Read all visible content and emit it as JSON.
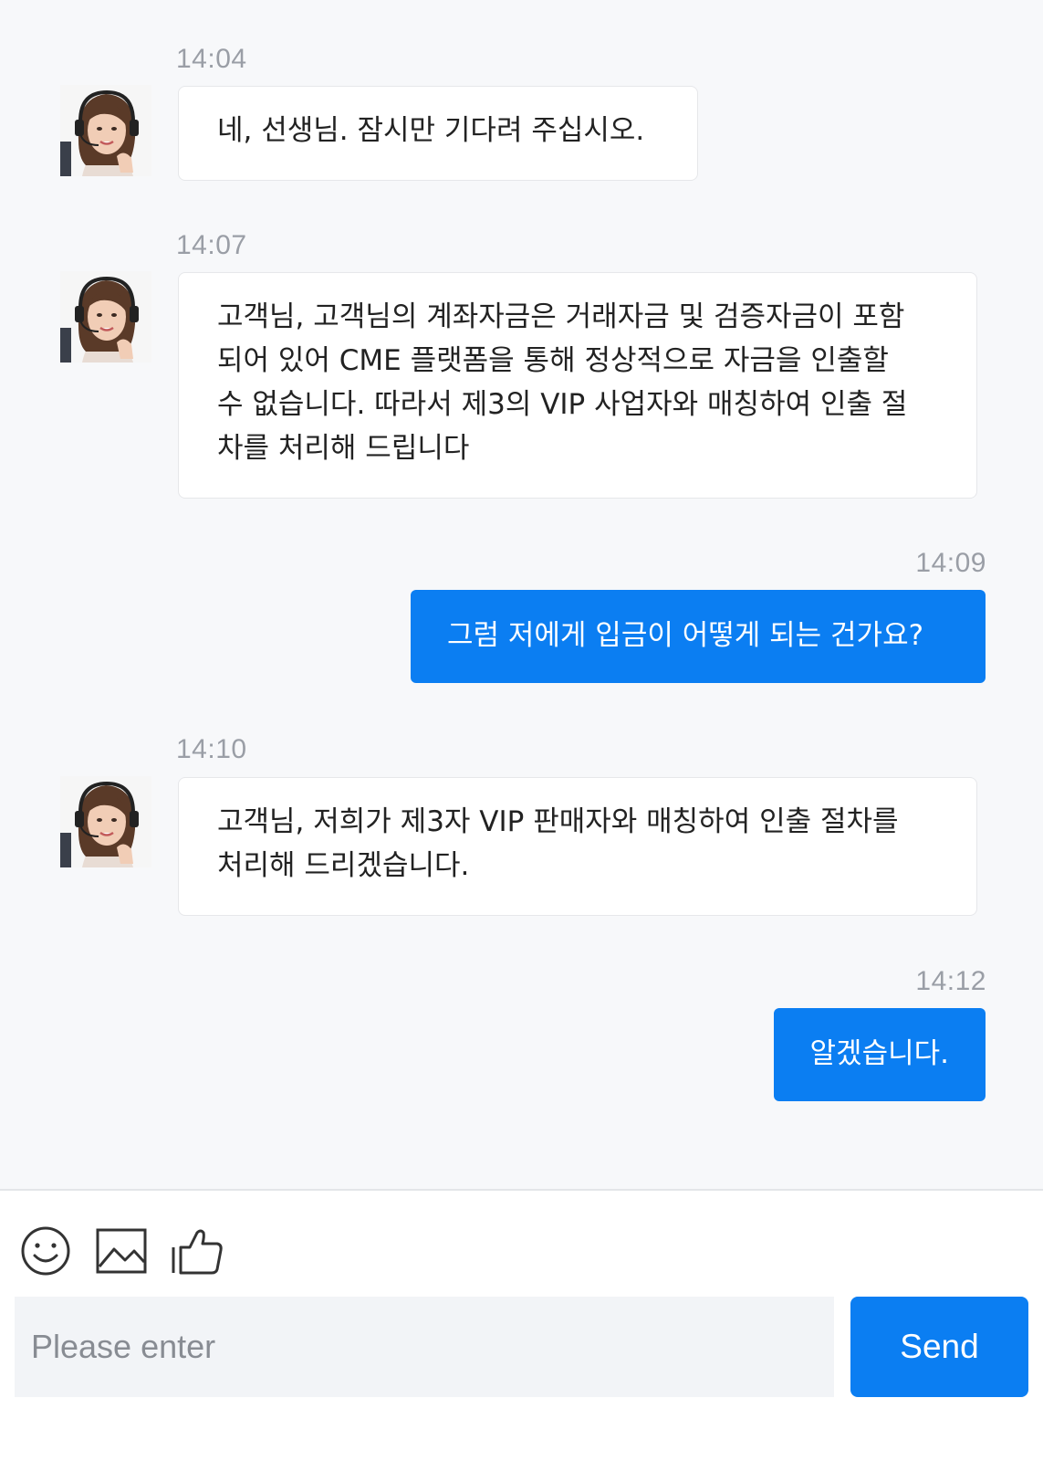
{
  "messages": [
    {
      "time": "14:04",
      "direction": "incoming",
      "lines": [
        "네, 선생님. 잠시만 기다려 주십시오."
      ]
    },
    {
      "time": "14:07",
      "direction": "incoming",
      "lines": [
        "고객님, 고객님의 계좌자금은 거래자금 및 검증자금이 포함",
        "되어 있어 CME 플랫폼을 통해 정상적으로 자금을 인출할",
        "수 없습니다. 따라서 제3의 VIP 사업자와 매칭하여 인출 절",
        "차를 처리해 드립니다"
      ]
    },
    {
      "time": "14:09",
      "direction": "outgoing",
      "lines": [
        "그럼 저에게 입금이 어떻게 되는 건가요?"
      ]
    },
    {
      "time": "14:10",
      "direction": "incoming",
      "lines": [
        "고객님, 저희가 제3자 VIP 판매자와 매칭하여 인출 절차를",
        "처리해 드리겠습니다."
      ]
    },
    {
      "time": "14:12",
      "direction": "outgoing",
      "lines": [
        "알겠습니다."
      ]
    }
  ],
  "composer": {
    "placeholder": "Please enter",
    "send_label": "Send",
    "tools": [
      "emoji-icon",
      "image-icon",
      "thumbs-up-icon"
    ]
  },
  "colors": {
    "accent": "#0b7ef2",
    "background": "#f7f8fa",
    "incoming_bubble": "#ffffff",
    "timestamp": "#9a9ea6"
  }
}
